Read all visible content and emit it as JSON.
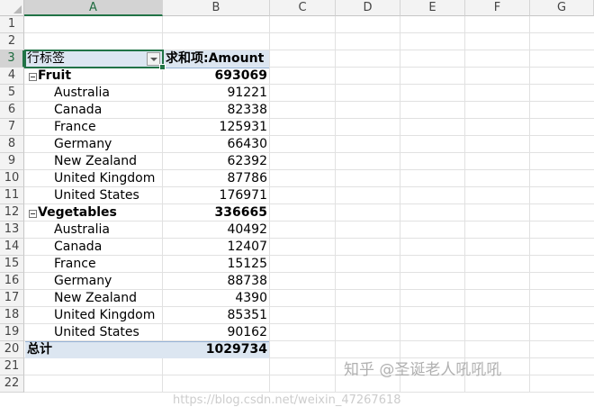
{
  "columns": [
    "A",
    "B",
    "C",
    "D",
    "E",
    "F",
    "G"
  ],
  "rows": [
    "1",
    "2",
    "3",
    "4",
    "5",
    "6",
    "7",
    "8",
    "9",
    "10",
    "11",
    "12",
    "13",
    "14",
    "15",
    "16",
    "17",
    "18",
    "19",
    "20",
    "21",
    "22"
  ],
  "pivot": {
    "row_label": "行标签",
    "value_label": "求和项:Amount",
    "groups": [
      {
        "name": "Fruit",
        "total": "693069",
        "items": [
          {
            "name": "Australia",
            "value": "91221"
          },
          {
            "name": "Canada",
            "value": "82338"
          },
          {
            "name": "France",
            "value": "125931"
          },
          {
            "name": "Germany",
            "value": "66430"
          },
          {
            "name": "New Zealand",
            "value": "62392"
          },
          {
            "name": "United Kingdom",
            "value": "87786"
          },
          {
            "name": "United States",
            "value": "176971"
          }
        ]
      },
      {
        "name": "Vegetables",
        "total": "336665",
        "items": [
          {
            "name": "Australia",
            "value": "40492"
          },
          {
            "name": "Canada",
            "value": "12407"
          },
          {
            "name": "France",
            "value": "15125"
          },
          {
            "name": "Germany",
            "value": "88738"
          },
          {
            "name": "New Zealand",
            "value": "4390"
          },
          {
            "name": "United Kingdom",
            "value": "85351"
          },
          {
            "name": "United States",
            "value": "90162"
          }
        ]
      }
    ],
    "grand_total_label": "总计",
    "grand_total": "1029734"
  },
  "watermark": {
    "text": "知乎 @圣诞老人吼吼吼",
    "url": "https://blog.csdn.net/weixin_47267618"
  },
  "colors": {
    "accent": "#217346",
    "pivot_band": "#dce6f1",
    "pivot_line": "#95b3d7"
  }
}
